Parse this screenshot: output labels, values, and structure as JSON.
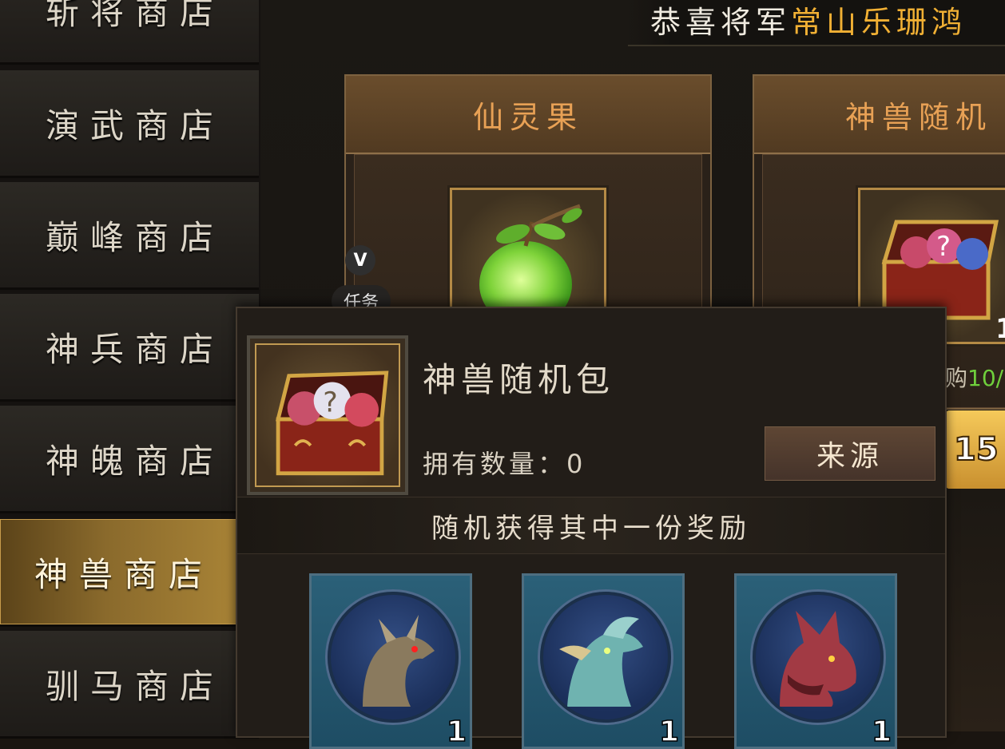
{
  "sidebar": {
    "items": [
      {
        "label": "斩将商店",
        "active": false
      },
      {
        "label": "演武商店",
        "active": false
      },
      {
        "label": "巅峰商店",
        "active": false
      },
      {
        "label": "神兵商店",
        "active": false
      },
      {
        "label": "神魄商店",
        "active": false
      },
      {
        "label": "神兽商店",
        "active": true
      },
      {
        "label": "驯马商店",
        "active": false
      }
    ]
  },
  "broadcast": {
    "prefix": "恭喜将军",
    "player_name": "常山乐珊",
    "suffix": "鸿"
  },
  "shop_cards": [
    {
      "title": "仙灵果",
      "item_icon": "green-apple-icon"
    },
    {
      "title": "神兽随机",
      "item_icon": "treasure-chest-icon",
      "quantity": "1"
    }
  ],
  "partial": {
    "price_prefix": "购",
    "price_value": "10/",
    "buy_number": "15"
  },
  "task_button": {
    "badge": "V",
    "label": "任务"
  },
  "popup": {
    "item_name": "神兽随机包",
    "item_icon": "treasure-chest-icon",
    "owned_label": "拥有数量：",
    "owned_value": "0",
    "source_button": "来源",
    "description": "随机获得其中一份奖励",
    "rewards": [
      {
        "icon": "dragon-portrait-icon",
        "count": "1"
      },
      {
        "icon": "griffin-portrait-icon",
        "count": "1"
      },
      {
        "icon": "red-wolf-portrait-icon",
        "count": "1"
      }
    ]
  },
  "colors": {
    "highlight_gold": "#f1b034",
    "card_title_orange": "#e8a155",
    "price_green": "#6fcf3c",
    "reward_teal": "#2b6078"
  }
}
